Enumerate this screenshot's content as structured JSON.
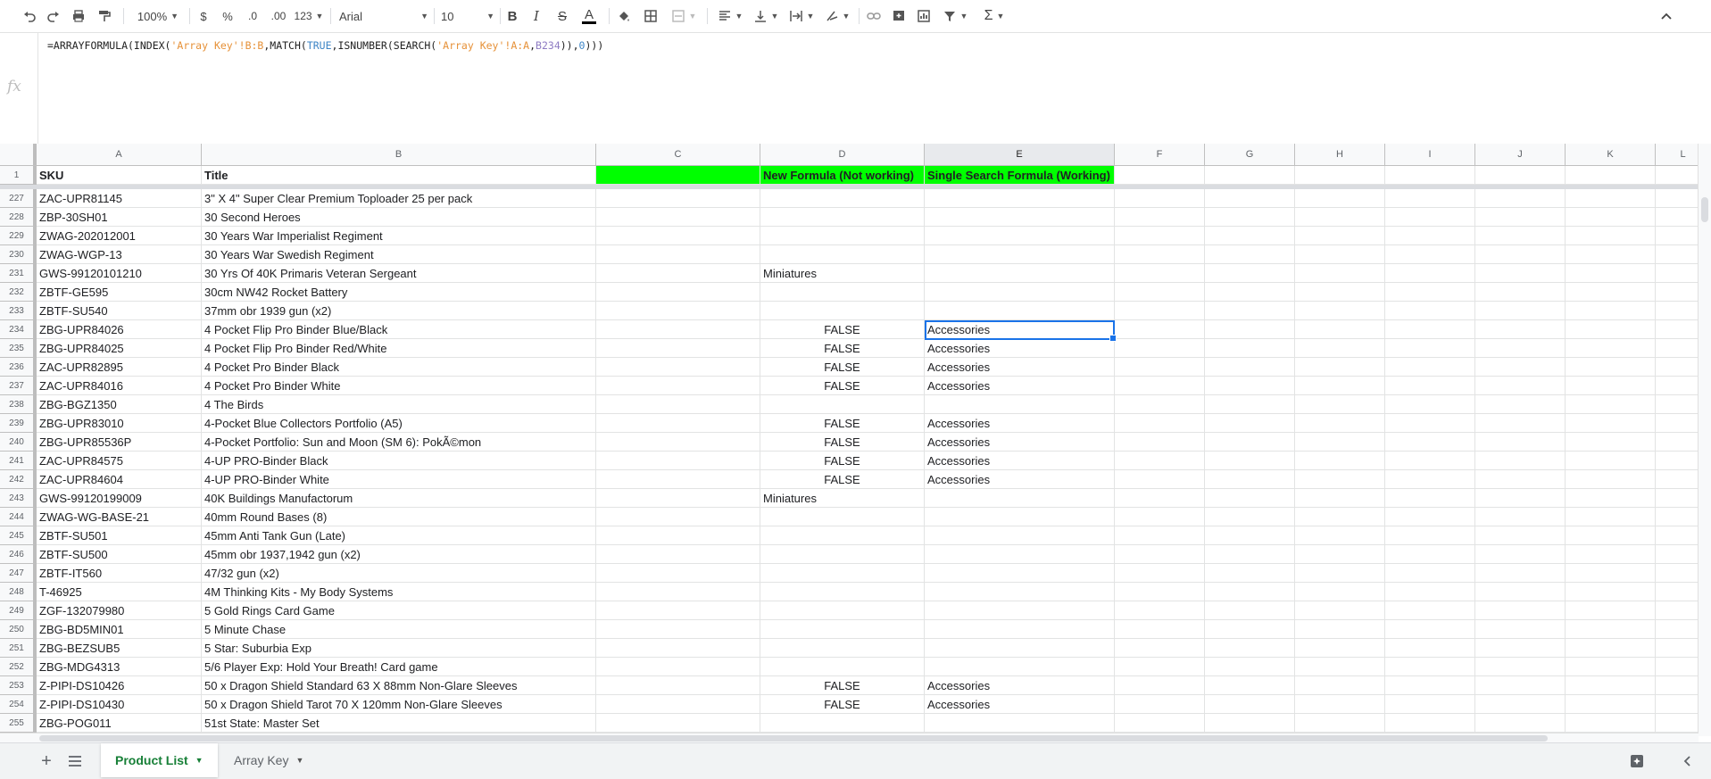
{
  "toolbar": {
    "zoom": "100%",
    "currency": "$",
    "percent": "%",
    "decimal_decrease": ".0",
    "decimal_increase": ".00",
    "number_format": "123",
    "font": "Arial",
    "font_size": "10"
  },
  "formula_bar": {
    "fx_label": "fx",
    "formula_parts": [
      "=ARRAYFORMULA(INDEX(",
      "'Array Key'",
      "!B:B",
      ",MATCH(",
      "TRUE",
      ",ISNUMBER(SEARCH(",
      "'Array Key'",
      "!A:A",
      ",",
      "B234",
      ")),",
      "0",
      ")))"
    ]
  },
  "columns": [
    "A",
    "B",
    "C",
    "D",
    "E",
    "F",
    "G",
    "H",
    "I",
    "J",
    "K",
    "L"
  ],
  "header_row": {
    "num": "1",
    "cells": [
      "SKU",
      "Title",
      "",
      "New Formula (Not working)",
      "Single Search Formula (Working)"
    ]
  },
  "rows": [
    {
      "num": "227",
      "a": "ZAC-UPR81145",
      "b": "3\" X 4\" Super Clear Premium Toploader 25 per pack",
      "d": "",
      "e": ""
    },
    {
      "num": "228",
      "a": "ZBP-30SH01",
      "b": "30 Second Heroes",
      "d": "",
      "e": ""
    },
    {
      "num": "229",
      "a": "ZWAG-202012001",
      "b": "30 Years War Imperialist Regiment",
      "d": "",
      "e": ""
    },
    {
      "num": "230",
      "a": "ZWAG-WGP-13",
      "b": "30 Years War Swedish Regiment",
      "d": "",
      "e": ""
    },
    {
      "num": "231",
      "a": "GWS-99120101210",
      "b": "30 Yrs Of 40K Primaris Veteran Sergeant",
      "d": "Miniatures",
      "e": ""
    },
    {
      "num": "232",
      "a": "ZBTF-GE595",
      "b": "30cm NW42 Rocket Battery",
      "d": "",
      "e": ""
    },
    {
      "num": "233",
      "a": "ZBTF-SU540",
      "b": "37mm obr 1939 gun (x2)",
      "d": "",
      "e": ""
    },
    {
      "num": "234",
      "a": "ZBG-UPR84026",
      "b": "4 Pocket Flip Pro Binder Blue/Black",
      "d": "FALSE",
      "e": "Accessories"
    },
    {
      "num": "235",
      "a": "ZBG-UPR84025",
      "b": "4 Pocket Flip Pro Binder Red/White",
      "d": "FALSE",
      "e": "Accessories"
    },
    {
      "num": "236",
      "a": "ZAC-UPR82895",
      "b": "4 Pocket Pro Binder Black",
      "d": "FALSE",
      "e": "Accessories"
    },
    {
      "num": "237",
      "a": "ZAC-UPR84016",
      "b": "4 Pocket Pro Binder White",
      "d": "FALSE",
      "e": "Accessories"
    },
    {
      "num": "238",
      "a": "ZBG-BGZ1350",
      "b": "4 The Birds",
      "d": "",
      "e": ""
    },
    {
      "num": "239",
      "a": "ZBG-UPR83010",
      "b": "4-Pocket Blue Collectors Portfolio (A5)",
      "d": "FALSE",
      "e": "Accessories"
    },
    {
      "num": "240",
      "a": "ZBG-UPR85536P",
      "b": "4-Pocket Portfolio: Sun and Moon (SM 6): PokÃ©mon",
      "d": "FALSE",
      "e": "Accessories"
    },
    {
      "num": "241",
      "a": "ZAC-UPR84575",
      "b": "4-UP PRO-Binder Black",
      "d": "FALSE",
      "e": "Accessories"
    },
    {
      "num": "242",
      "a": "ZAC-UPR84604",
      "b": "4-UP PRO-Binder White",
      "d": "FALSE",
      "e": "Accessories"
    },
    {
      "num": "243",
      "a": "GWS-99120199009",
      "b": "40K Buildings Manufactorum",
      "d": "Miniatures",
      "e": ""
    },
    {
      "num": "244",
      "a": "ZWAG-WG-BASE-21",
      "b": "40mm Round Bases (8)",
      "d": "",
      "e": ""
    },
    {
      "num": "245",
      "a": "ZBTF-SU501",
      "b": "45mm Anti Tank Gun (Late)",
      "d": "",
      "e": ""
    },
    {
      "num": "246",
      "a": "ZBTF-SU500",
      "b": "45mm obr 1937,1942 gun (x2)",
      "d": "",
      "e": ""
    },
    {
      "num": "247",
      "a": "ZBTF-IT560",
      "b": "47/32 gun (x2)",
      "d": "",
      "e": ""
    },
    {
      "num": "248",
      "a": "T-46925",
      "b": "4M Thinking Kits - My Body Systems",
      "d": "",
      "e": ""
    },
    {
      "num": "249",
      "a": "ZGF-132079980",
      "b": "5 Gold Rings Card Game",
      "d": "",
      "e": ""
    },
    {
      "num": "250",
      "a": "ZBG-BD5MIN01",
      "b": "5 Minute Chase",
      "d": "",
      "e": ""
    },
    {
      "num": "251",
      "a": "ZBG-BEZSUB5",
      "b": "5 Star: Suburbia Exp",
      "d": "",
      "e": ""
    },
    {
      "num": "252",
      "a": "ZBG-MDG4313",
      "b": "5/6 Player Exp: Hold Your Breath! Card game",
      "d": "",
      "e": ""
    },
    {
      "num": "253",
      "a": "Z-PIPI-DS10426",
      "b": "50 x Dragon Shield Standard 63 X 88mm Non-Glare Sleeves",
      "d": "FALSE",
      "e": "Accessories"
    },
    {
      "num": "254",
      "a": "Z-PIPI-DS10430",
      "b": "50 x Dragon Shield Tarot 70 X 120mm Non-Glare Sleeves",
      "d": "FALSE",
      "e": "Accessories"
    },
    {
      "num": "255",
      "a": "ZBG-POG011",
      "b": "51st State: Master Set",
      "d": "",
      "e": ""
    }
  ],
  "sheets": [
    {
      "label": "Product List",
      "active": true
    },
    {
      "label": "Array Key",
      "active": false
    }
  ],
  "colors": {
    "accent": "#188038",
    "selection": "#1a73e8",
    "highlight_green": "#00ff00"
  }
}
